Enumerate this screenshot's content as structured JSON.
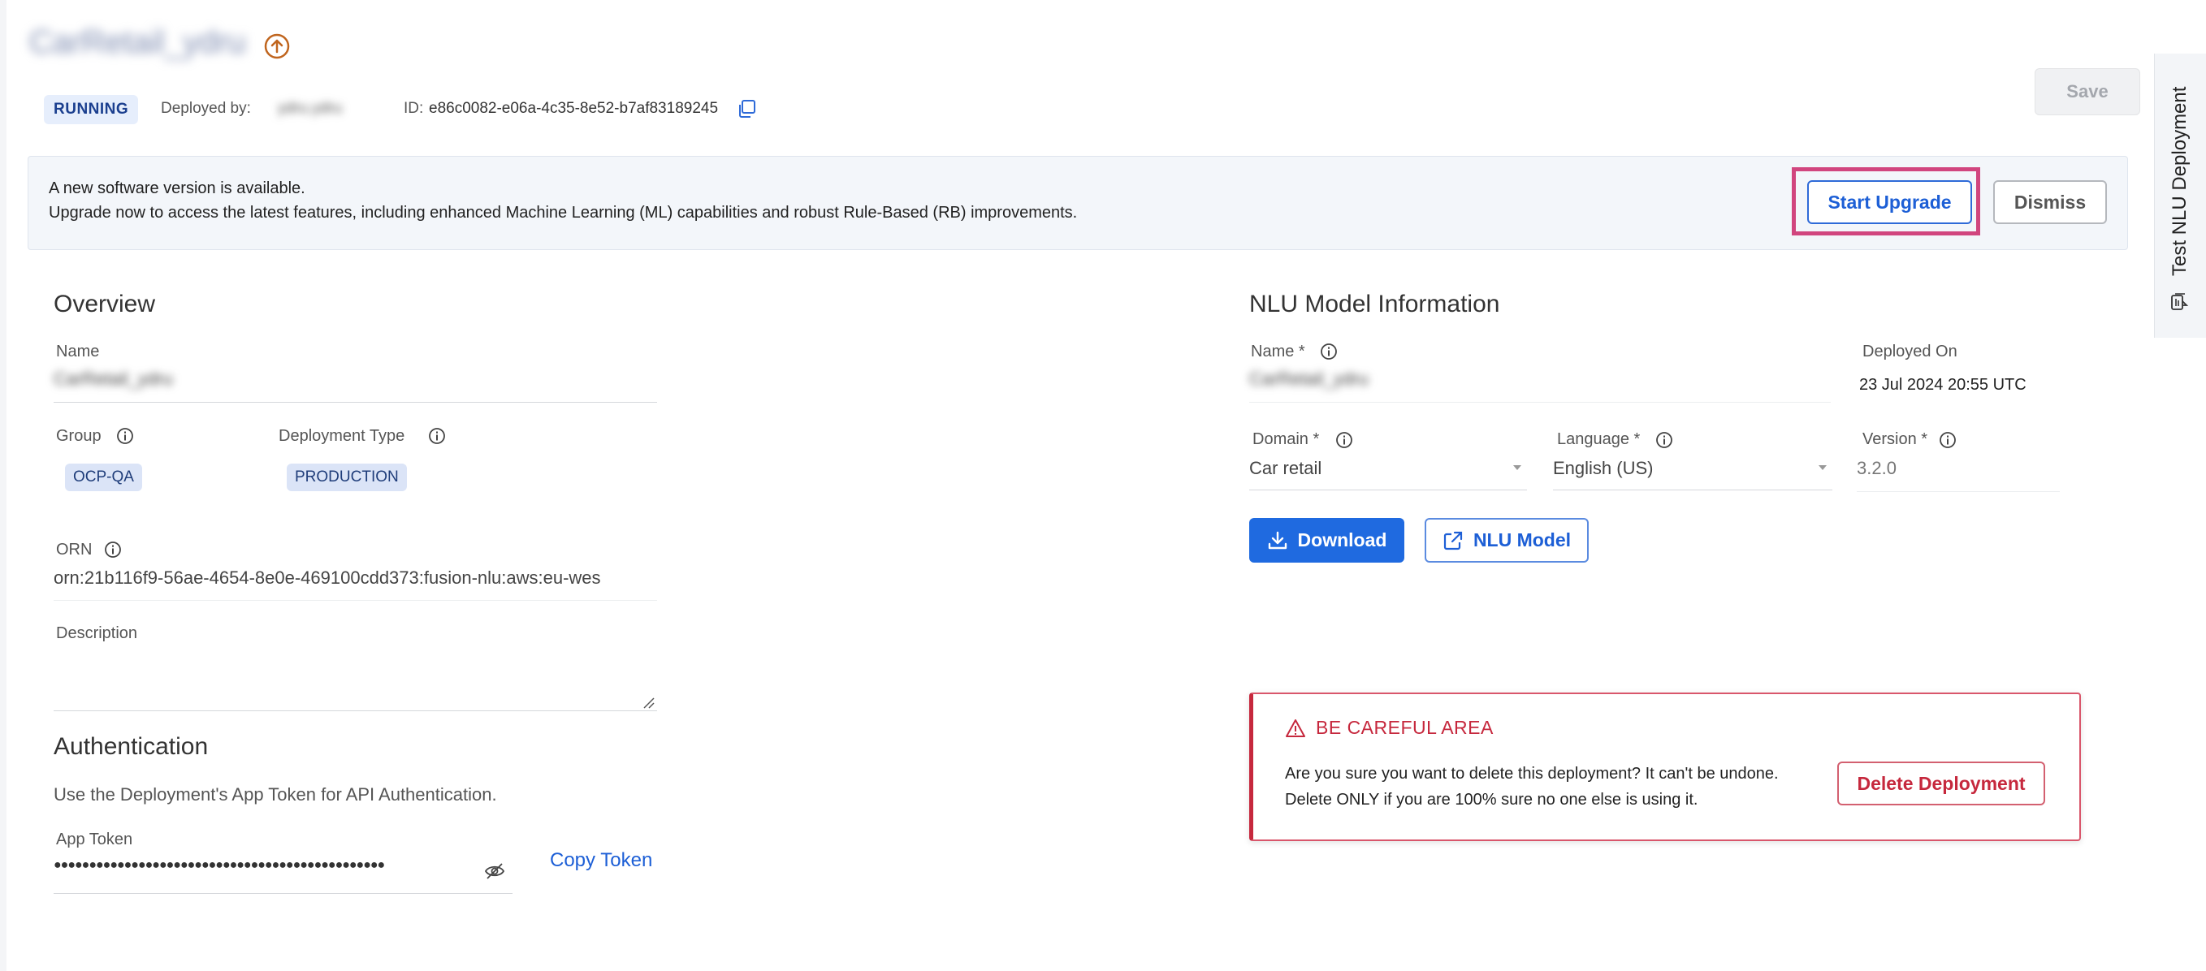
{
  "header": {
    "title": "CarRetail_ydru",
    "status": "RUNNING",
    "deployed_by_label": "Deployed by:",
    "deployed_by_value": "ydru.ydru",
    "id_label": "ID:",
    "id_value": "e86c0082-e06a-4c35-8e52-b7af83189245",
    "save_label": "Save"
  },
  "banner": {
    "title": "A new software version is available.",
    "text": "Upgrade now to access the latest features, including enhanced Machine Learning (ML) capabilities and robust Rule-Based (RB) improvements.",
    "start_upgrade": "Start Upgrade",
    "dismiss": "Dismiss"
  },
  "overview": {
    "heading": "Overview",
    "name_label": "Name",
    "name_value": "CarRetail_ydru",
    "group_label": "Group",
    "group_value": "OCP-QA",
    "deployment_type_label": "Deployment Type",
    "deployment_type_value": "PRODUCTION",
    "orn_label": "ORN",
    "orn_value": "orn:21b116f9-56ae-4654-8e0e-469100cdd373:fusion-nlu:aws:eu-wes",
    "description_label": "Description",
    "description_value": ""
  },
  "authentication": {
    "heading": "Authentication",
    "text": "Use the Deployment's App Token for API Authentication.",
    "token_label": "App Token",
    "token_value": "●●●●●●●●●●●●●●●●●●●●●●●●●●●●●●●●●●●●●●●●●●●●●●●",
    "copy_token": "Copy Token"
  },
  "nlu_model": {
    "heading": "NLU Model Information",
    "name_label": "Name *",
    "name_value": "CarRetail_ydru",
    "deployed_on_label": "Deployed On",
    "deployed_on_value": "23 Jul 2024 20:55 UTC",
    "domain_label": "Domain *",
    "domain_value": "Car retail",
    "language_label": "Language *",
    "language_value": "English (US)",
    "version_label": "Version *",
    "version_value": "3.2.0",
    "download": "Download",
    "nlu_model_button": "NLU Model"
  },
  "careful": {
    "title": "BE CAREFUL AREA",
    "text": "Are you sure you want to delete this deployment? It can't be undone. Delete ONLY if you are 100% sure no one else is using it.",
    "delete_button": "Delete Deployment"
  },
  "side_tab": {
    "label": "Test NLU Deployment"
  },
  "colors": {
    "primary": "#1f6ae0",
    "danger": "#c6283d",
    "highlight": "#d1457e",
    "upgrade_icon": "#c0651e"
  }
}
